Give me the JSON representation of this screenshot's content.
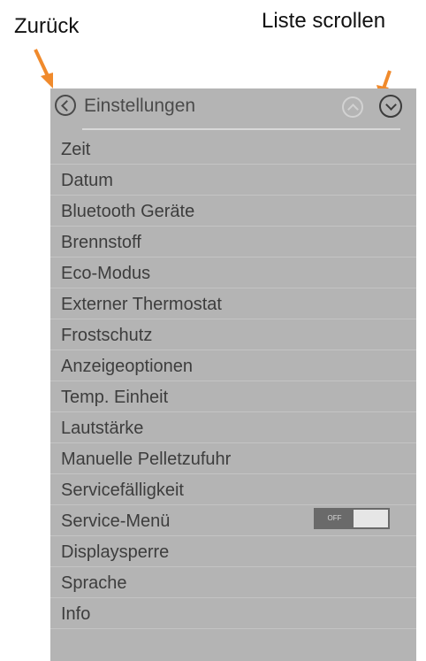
{
  "annotations": {
    "back": "Zurück",
    "scroll": "Liste scrollen"
  },
  "header": {
    "title": "Einstellungen",
    "back_icon": "chevron-left-circle-icon",
    "scroll_up_icon": "chevron-up-circle-icon",
    "scroll_down_icon": "chevron-down-circle-icon"
  },
  "settings": {
    "items": [
      {
        "label": "Zeit"
      },
      {
        "label": "Datum"
      },
      {
        "label": "Bluetooth Geräte"
      },
      {
        "label": "Brennstoff"
      },
      {
        "label": "Eco-Modus"
      },
      {
        "label": "Externer Thermostat"
      },
      {
        "label": "Frostschutz"
      },
      {
        "label": "Anzeigeoptionen"
      },
      {
        "label": "Temp. Einheit"
      },
      {
        "label": "Lautstärke"
      },
      {
        "label": "Manuelle Pelletzufuhr"
      },
      {
        "label": "Servicefälligkeit"
      },
      {
        "label": "Service-Menü",
        "toggle": "OFF"
      },
      {
        "label": "Displaysperre"
      },
      {
        "label": "Sprache"
      },
      {
        "label": "Info"
      }
    ]
  },
  "colors": {
    "panel_bg": "#b4b4b4",
    "text": "#3d3d3d",
    "annotation_arrow": "#f08a2c"
  }
}
